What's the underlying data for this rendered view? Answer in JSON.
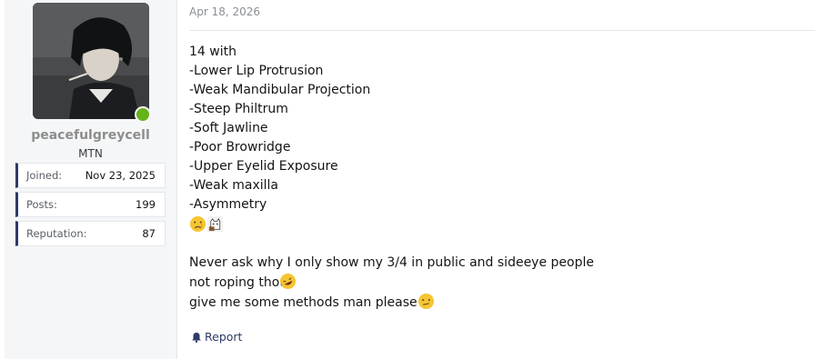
{
  "user": {
    "username": "peacefulgreycell",
    "title": "MTN",
    "status_color": "#66b319",
    "stats": [
      {
        "label": "Joined:",
        "value": "Nov 23, 2025"
      },
      {
        "label": "Posts:",
        "value": "199"
      },
      {
        "label": "Reputation:",
        "value": "87"
      }
    ]
  },
  "post": {
    "date": "Apr 18, 2026",
    "lines": [
      "14 with",
      "-Lower Lip Protrusion",
      "-Weak Mandibular Projection",
      "-Steep Philtrum",
      "-Soft Jawline",
      "-Poor Browridge",
      "-Upper Eyelid Exposure",
      "-Weak maxilla",
      "-Asymmetry"
    ],
    "emoji_row": [
      "crying-face-icon",
      "cat-sticker-icon"
    ],
    "paragraph": [
      {
        "text": "Never ask why I only show my 3/4 in public and sideeye people",
        "emoji": ""
      },
      {
        "text": "not roping tho",
        "emoji": "rofl-emoji-icon"
      },
      {
        "text": "give me some methods man please",
        "emoji": "confused-face-icon"
      }
    ],
    "report_label": "Report"
  },
  "colors": {
    "accent": "#2c3a66",
    "panel_bg": "#f5f6f8"
  }
}
